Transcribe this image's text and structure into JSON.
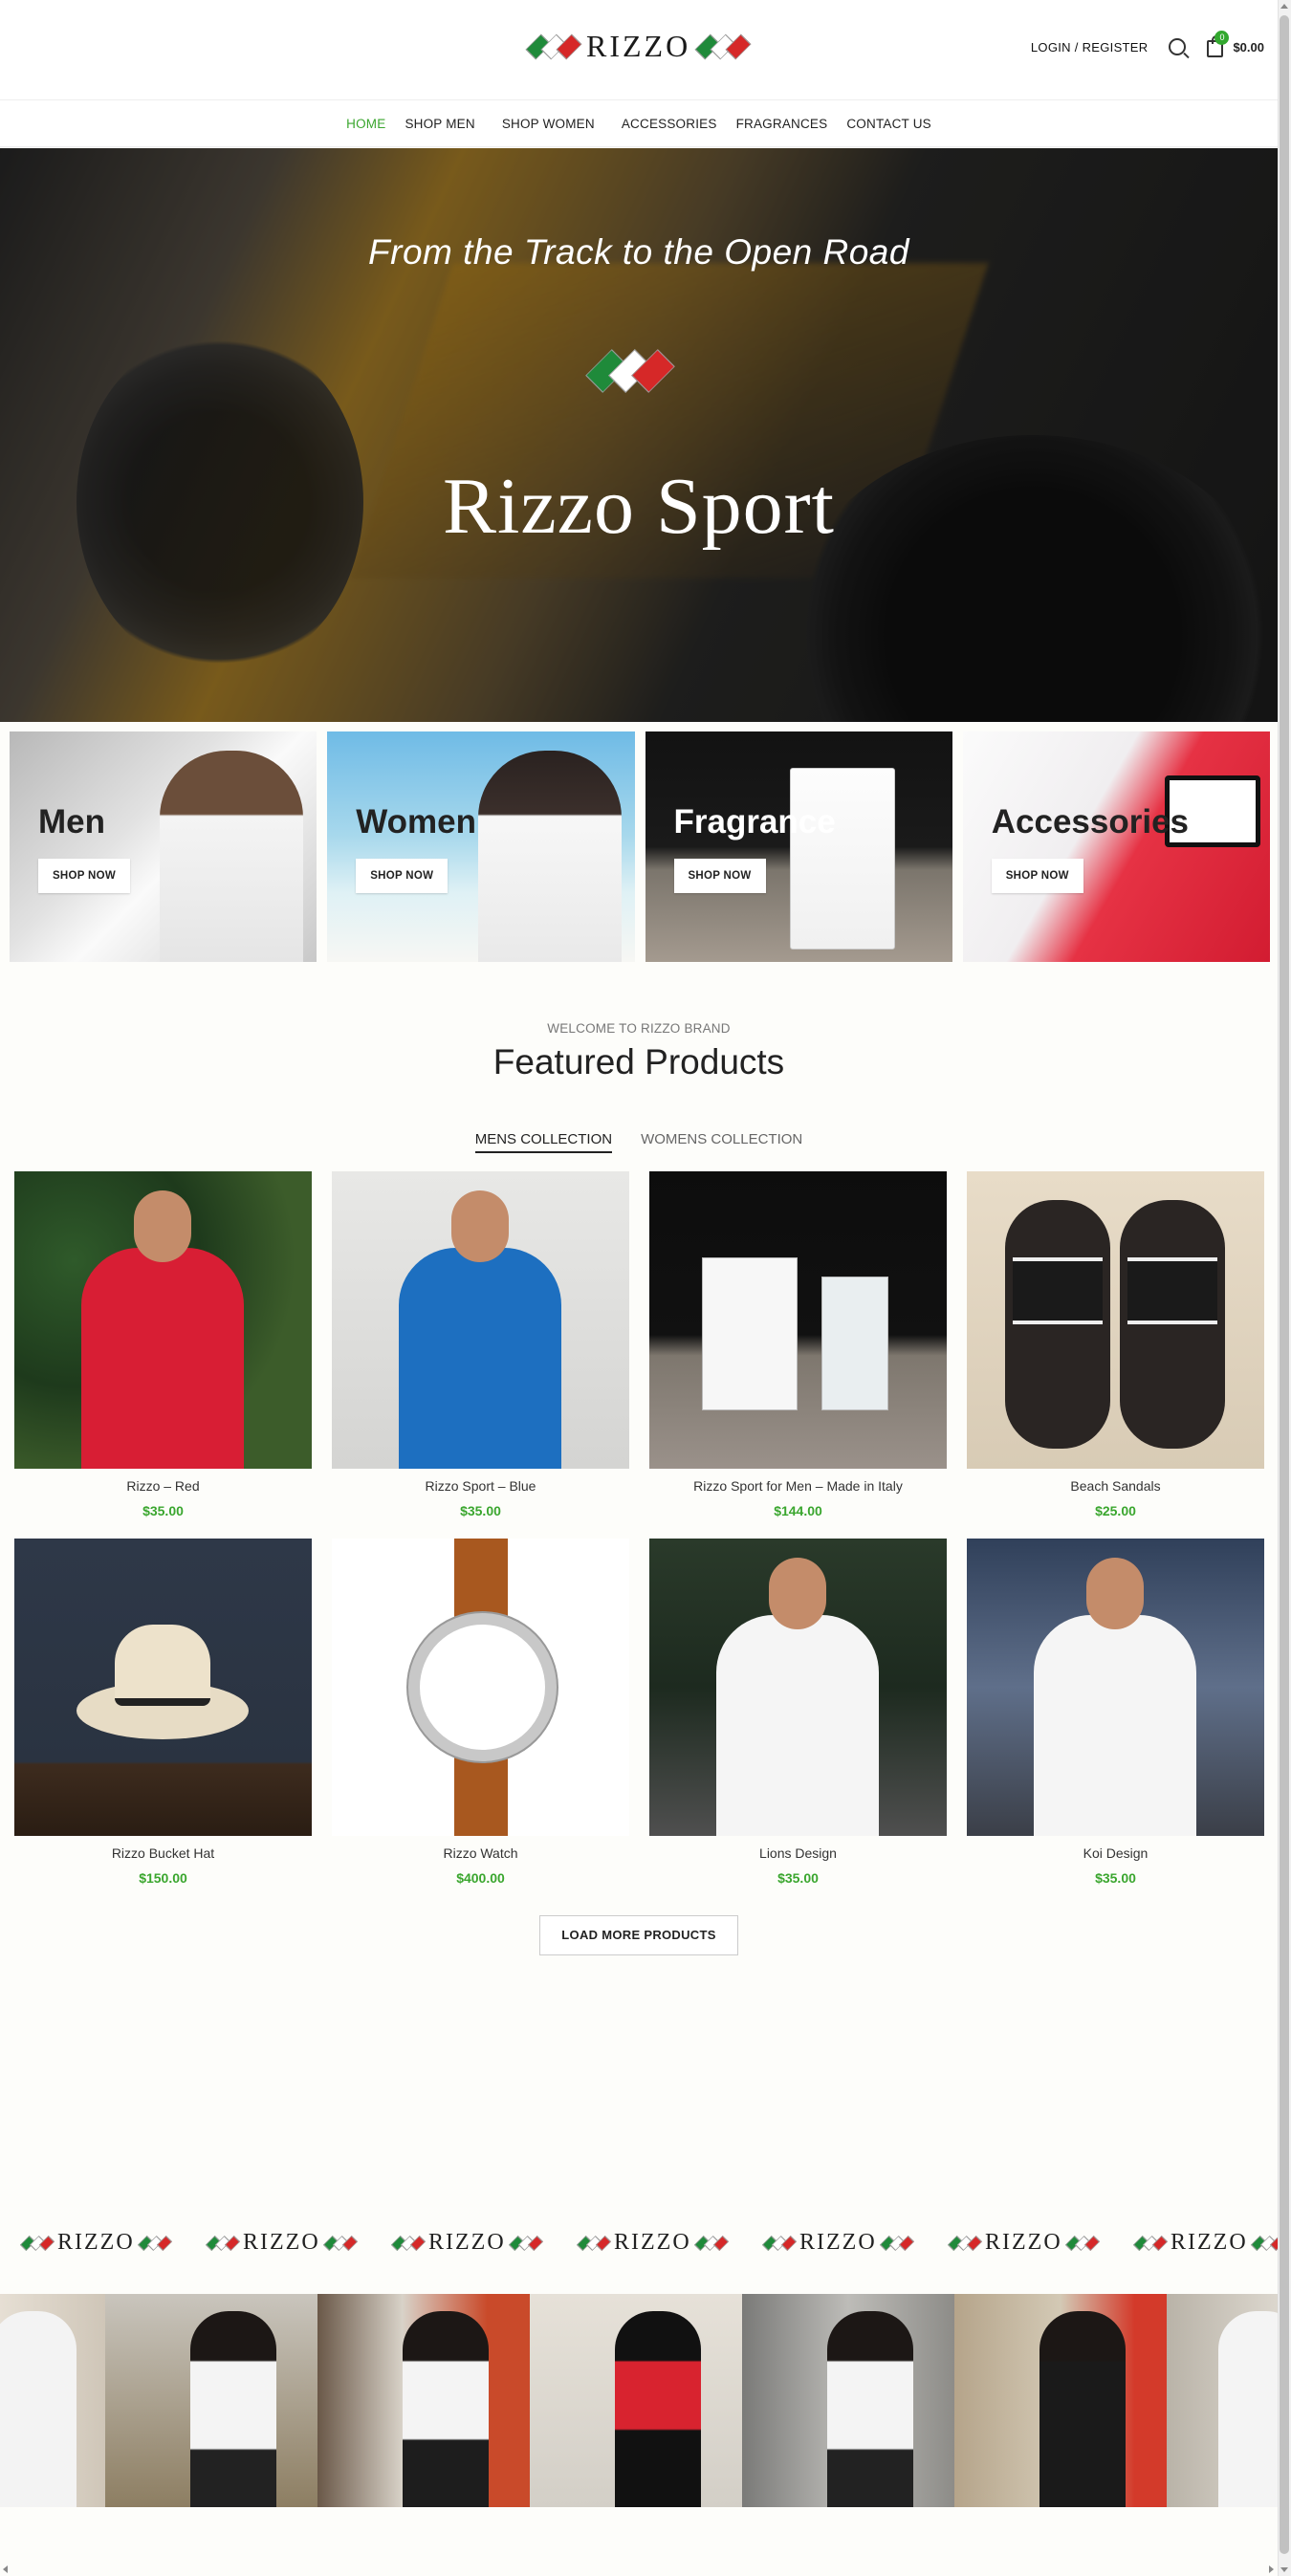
{
  "header": {
    "brand": "RIZZO",
    "login_label": "LOGIN / REGISTER",
    "cart_count": "0",
    "cart_total": "$0.00"
  },
  "nav": {
    "items": [
      "HOME",
      "SHOP MEN",
      "SHOP WOMEN",
      "ACCESSORIES",
      "FRAGRANCES",
      "CONTACT US"
    ]
  },
  "hero": {
    "tagline": "From the Track to the Open Road",
    "title": "Rizzo Sport"
  },
  "categories": [
    {
      "title": "Men",
      "button": "SHOP NOW"
    },
    {
      "title": "Women",
      "button": "SHOP NOW"
    },
    {
      "title": "Fragrance",
      "button": "SHOP NOW"
    },
    {
      "title": "Accessories",
      "button": "SHOP NOW"
    }
  ],
  "featured": {
    "eyebrow": "WELCOME TO RIZZO BRAND",
    "title": "Featured Products",
    "tabs": [
      "MENS COLLECTION",
      "WOMENS COLLECTION"
    ]
  },
  "products": [
    {
      "name": "Rizzo – Red",
      "price": "$35.00"
    },
    {
      "name": "Rizzo Sport – Blue",
      "price": "$35.00"
    },
    {
      "name": "Rizzo Sport for Men – Made in Italy",
      "price": "$144.00"
    },
    {
      "name": "Beach Sandals",
      "price": "$25.00"
    },
    {
      "name": "Rizzo Bucket Hat",
      "price": "$150.00"
    },
    {
      "name": "Rizzo Watch",
      "price": "$400.00"
    },
    {
      "name": "Lions Design",
      "price": "$35.00"
    },
    {
      "name": "Koi Design",
      "price": "$35.00"
    }
  ],
  "load_more_label": "LOAD MORE PRODUCTS",
  "marquee_brand": "RIZZO",
  "colors": {
    "accent_green": "#3aa62e",
    "flag_green": "#1f8a3a",
    "flag_red": "#d62828"
  },
  "icons": [
    "search-icon",
    "cart-icon",
    "scroll-up-icon",
    "scroll-down-icon"
  ]
}
